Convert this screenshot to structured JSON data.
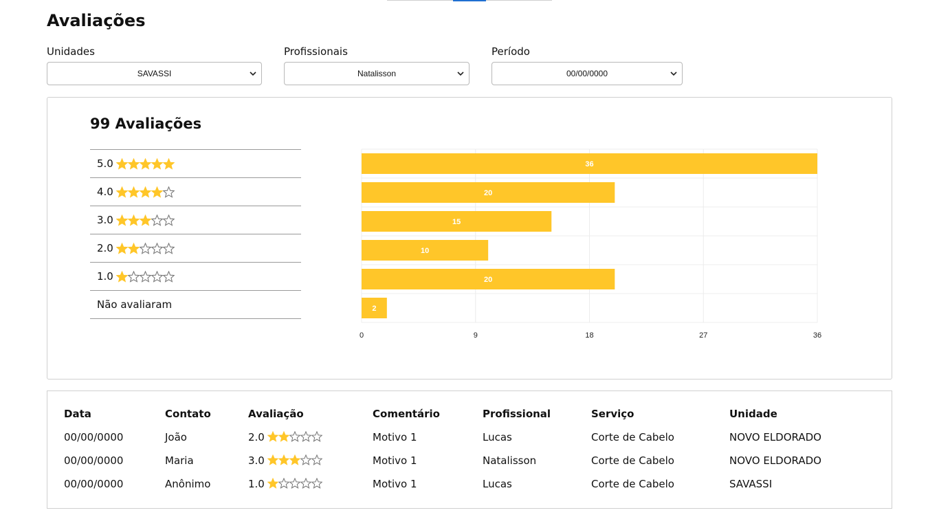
{
  "page": {
    "title": "Avaliações"
  },
  "filters": [
    {
      "label": "Unidades",
      "value": "SAVASSI"
    },
    {
      "label": "Profissionais",
      "value": "Natalisson"
    },
    {
      "label": "Período",
      "value": "00/00/0000"
    }
  ],
  "summary": {
    "title": "99 Avaliações",
    "rows": [
      {
        "label": "5.0",
        "stars": 5
      },
      {
        "label": "4.0",
        "stars": 4
      },
      {
        "label": "3.0",
        "stars": 3
      },
      {
        "label": "2.0",
        "stars": 2
      },
      {
        "label": "1.0",
        "stars": 1
      },
      {
        "label": "Não avaliaram",
        "stars": 0
      }
    ]
  },
  "colors": {
    "accent": "#ffc629",
    "star": "#ffc629",
    "grid": "#ececec",
    "border": "#cfcfcf"
  },
  "chart_data": {
    "type": "bar",
    "orientation": "horizontal",
    "categories": [
      "5.0",
      "4.0",
      "3.0",
      "2.0",
      "1.0",
      "Não avaliaram"
    ],
    "values": [
      36,
      20,
      15,
      10,
      20,
      2
    ],
    "xlim": [
      0,
      36
    ],
    "xticks": [
      "0",
      "9",
      "18",
      "27",
      "36"
    ],
    "grid": true,
    "data_labels": true
  },
  "table": {
    "headers": [
      "Data",
      "Contato",
      "Avaliação",
      "Comentário",
      "Profissional",
      "Serviço",
      "Unidade"
    ],
    "rows": [
      {
        "data": "00/00/0000",
        "contato": "João",
        "avaliacao": "2.0",
        "stars": 2,
        "comentario": "Motivo 1",
        "profissional": "Lucas",
        "servico": "Corte de Cabelo",
        "unidade": "NOVO ELDORADO"
      },
      {
        "data": "00/00/0000",
        "contato": "Maria",
        "avaliacao": "3.0",
        "stars": 3,
        "comentario": "Motivo 1",
        "profissional": "Natalisson",
        "servico": "Corte de Cabelo",
        "unidade": "NOVO ELDORADO"
      },
      {
        "data": "00/00/0000",
        "contato": "Anônimo",
        "avaliacao": "1.0",
        "stars": 1,
        "comentario": "Motivo 1",
        "profissional": "Lucas",
        "servico": "Corte de Cabelo",
        "unidade": "SAVASSI"
      }
    ]
  }
}
